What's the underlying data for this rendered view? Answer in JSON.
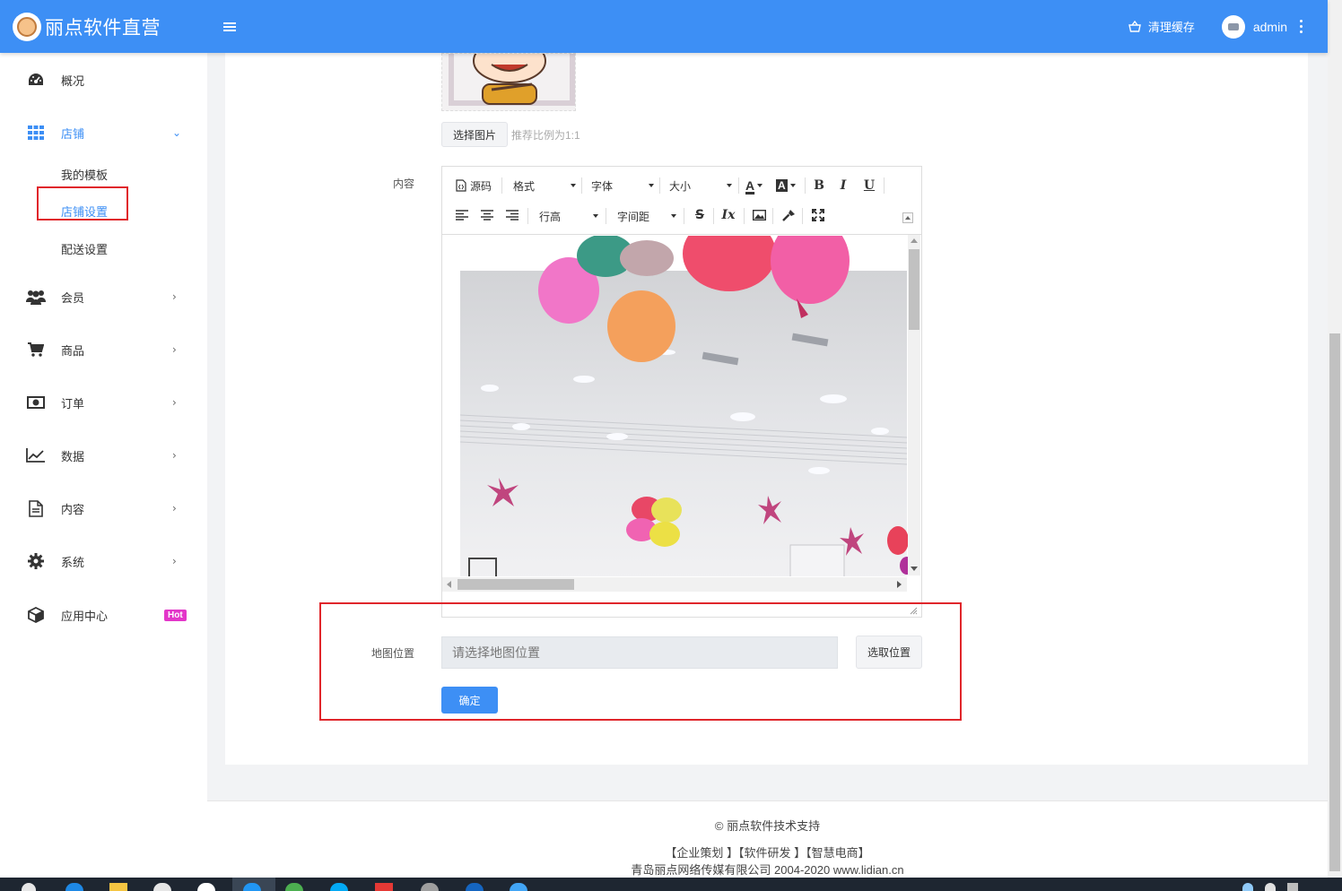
{
  "app": {
    "logo_text": "丽点软件直营"
  },
  "header": {
    "clear_cache": "清理缓存",
    "user": "admin"
  },
  "sidebar": {
    "items": [
      {
        "label": "概况",
        "icon": "dashboard-icon"
      },
      {
        "label": "店铺",
        "icon": "grid-icon"
      },
      {
        "label": "会员",
        "icon": "users-icon"
      },
      {
        "label": "商品",
        "icon": "cart-icon"
      },
      {
        "label": "订单",
        "icon": "money-icon"
      },
      {
        "label": "数据",
        "icon": "chart-line-icon"
      },
      {
        "label": "内容",
        "icon": "document-icon"
      },
      {
        "label": "系统",
        "icon": "gear-icon"
      },
      {
        "label": "应用中心",
        "icon": "cube-icon"
      }
    ],
    "sub_items": [
      "我的模板",
      "店铺设置",
      "配送设置"
    ],
    "hot_badge": "Hot"
  },
  "form": {
    "select_image_button": "选择图片",
    "image_hint": "推荐比例为1:1",
    "content_label": "内容",
    "map_label": "地图位置",
    "map_placeholder": "请选择地图位置",
    "pick_location_button": "选取位置",
    "confirm_button": "确定"
  },
  "editor": {
    "source": "源码",
    "format": "格式",
    "font": "字体",
    "size": "大小",
    "line_height": "行高",
    "letter_spacing": "字间距",
    "bold": "B",
    "italic": "I",
    "underline": "U",
    "font_color": "A",
    "bg_color": "A",
    "strike": "S",
    "clear_format": "Ix"
  },
  "footer": {
    "support": "© 丽点软件技术支持",
    "services": "【企业策划 】【软件研发 】【智慧电商】",
    "company": "青岛丽点网络传媒有限公司 2004-2020 www.lidian.cn"
  }
}
